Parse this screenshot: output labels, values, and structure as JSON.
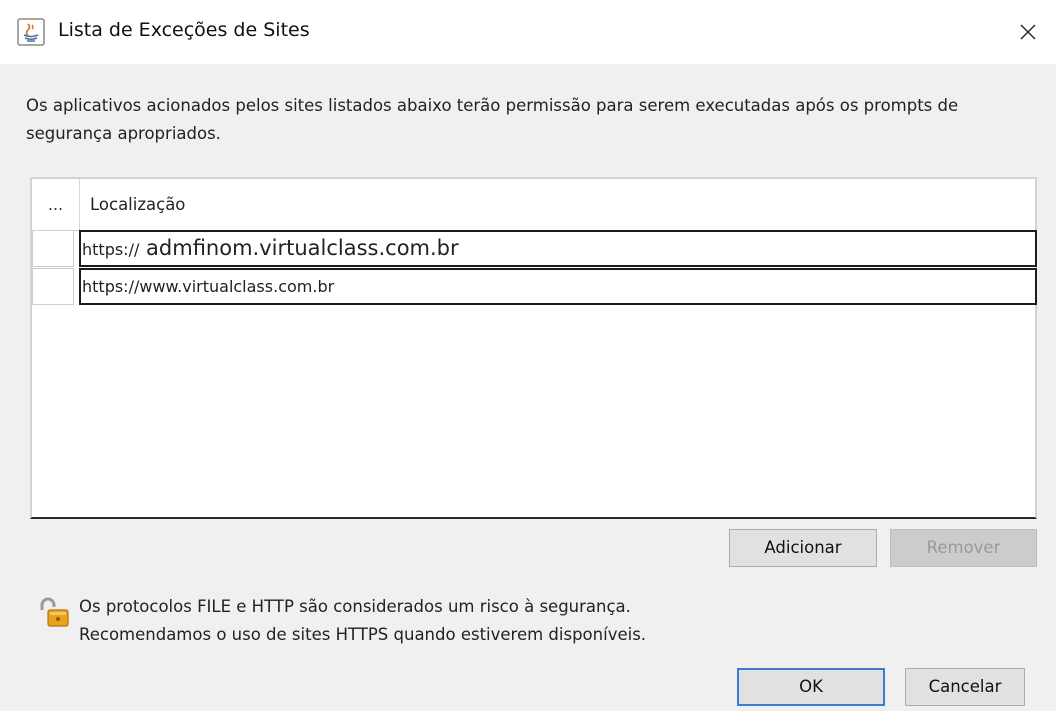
{
  "window": {
    "title": "Lista de Exceções de Sites",
    "close_glyph": "✕"
  },
  "description": "Os aplicativos acionados pelos sites listados abaixo terão permissão para serem executadas após os prompts de segurança apropriados.",
  "table": {
    "columns": [
      "...",
      "Localização"
    ],
    "rows": [
      {
        "prefix": "https://",
        "domain": " admfinom.virtualclass.com.br"
      },
      {
        "url": "https://www.virtualclass.com.br"
      }
    ]
  },
  "buttons": {
    "add": "Adicionar",
    "remove": "Remover",
    "ok": "OK",
    "cancel": "Cancelar"
  },
  "warning": {
    "line1": "Os protocolos FILE e HTTP são considerados um risco à segurança.",
    "line2": "Recomendamos o uso de sites HTTPS quando estiverem disponíveis."
  },
  "icons": {
    "app": "java-icon",
    "close": "close-icon",
    "warning": "unlocked-padlock-icon"
  },
  "colors": {
    "ok_focus_border": "#3b7bd0",
    "window_bg": "#f0f0f0"
  }
}
